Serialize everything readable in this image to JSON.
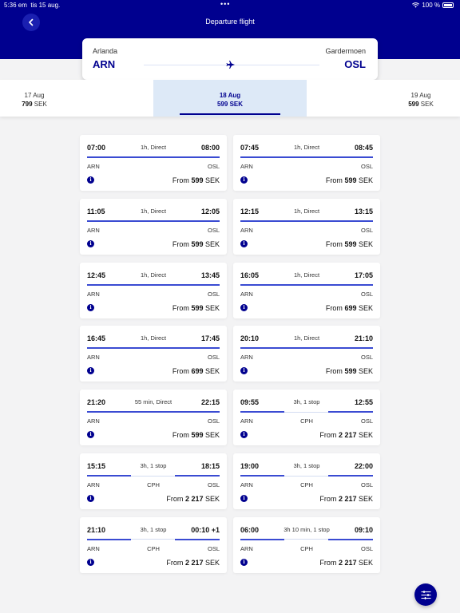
{
  "status_bar": {
    "time": "5:36 em",
    "date": "tis 15 aug.",
    "battery": "100 %"
  },
  "header": {
    "title": "Departure flight"
  },
  "route": {
    "from_city": "Arlanda",
    "from_code": "ARN",
    "to_city": "Gardermoen",
    "to_code": "OSL"
  },
  "dates": [
    {
      "date": "17 Aug",
      "price": "799",
      "currency": "SEK"
    },
    {
      "date": "18 Aug",
      "price": "599",
      "currency": "SEK"
    },
    {
      "date": "19 Aug",
      "price": "599",
      "currency": "SEK"
    }
  ],
  "from_label": "From",
  "currency": "SEK",
  "info_icon_glyph": "i",
  "flights": [
    {
      "dep": "07:00",
      "arr": "08:00",
      "duration": "1h, Direct",
      "from": "ARN",
      "stop": "",
      "to": "OSL",
      "price": "599"
    },
    {
      "dep": "07:45",
      "arr": "08:45",
      "duration": "1h, Direct",
      "from": "ARN",
      "stop": "",
      "to": "OSL",
      "price": "599"
    },
    {
      "dep": "11:05",
      "arr": "12:05",
      "duration": "1h, Direct",
      "from": "ARN",
      "stop": "",
      "to": "OSL",
      "price": "599"
    },
    {
      "dep": "12:15",
      "arr": "13:15",
      "duration": "1h, Direct",
      "from": "ARN",
      "stop": "",
      "to": "OSL",
      "price": "599"
    },
    {
      "dep": "12:45",
      "arr": "13:45",
      "duration": "1h, Direct",
      "from": "ARN",
      "stop": "",
      "to": "OSL",
      "price": "599"
    },
    {
      "dep": "16:05",
      "arr": "17:05",
      "duration": "1h, Direct",
      "from": "ARN",
      "stop": "",
      "to": "OSL",
      "price": "699"
    },
    {
      "dep": "16:45",
      "arr": "17:45",
      "duration": "1h, Direct",
      "from": "ARN",
      "stop": "",
      "to": "OSL",
      "price": "699"
    },
    {
      "dep": "20:10",
      "arr": "21:10",
      "duration": "1h, Direct",
      "from": "ARN",
      "stop": "",
      "to": "OSL",
      "price": "599"
    },
    {
      "dep": "21:20",
      "arr": "22:15",
      "duration": "55 min, Direct",
      "from": "ARN",
      "stop": "",
      "to": "OSL",
      "price": "599"
    },
    {
      "dep": "09:55",
      "arr": "12:55",
      "duration": "3h, 1 stop",
      "from": "ARN",
      "stop": "CPH",
      "to": "OSL",
      "price": "2 217"
    },
    {
      "dep": "15:15",
      "arr": "18:15",
      "duration": "3h, 1 stop",
      "from": "ARN",
      "stop": "CPH",
      "to": "OSL",
      "price": "2 217"
    },
    {
      "dep": "19:00",
      "arr": "22:00",
      "duration": "3h, 1 stop",
      "from": "ARN",
      "stop": "CPH",
      "to": "OSL",
      "price": "2 217"
    },
    {
      "dep": "21:10",
      "arr": "00:10 +1",
      "duration": "3h, 1 stop",
      "from": "ARN",
      "stop": "CPH",
      "to": "OSL",
      "price": "2 217"
    },
    {
      "dep": "06:00",
      "arr": "09:10",
      "duration": "3h 10 min, 1 stop",
      "from": "ARN",
      "stop": "CPH",
      "to": "OSL",
      "price": "2 217"
    }
  ],
  "colors": {
    "brand": "#00008f",
    "accent_line": "#3a4bd2",
    "selected_tab": "#dde9f7"
  },
  "icons": {
    "back": "chevron-left-icon",
    "plane": "airplane-icon",
    "info": "info-icon",
    "filter": "filter-sliders-icon"
  }
}
